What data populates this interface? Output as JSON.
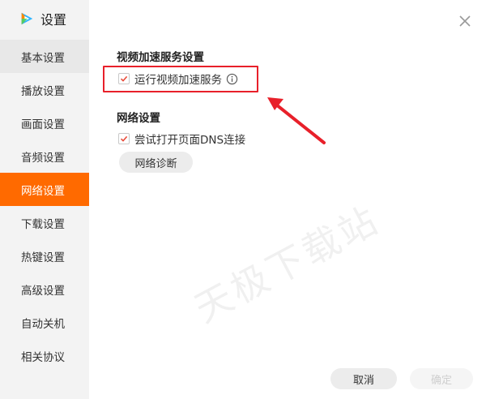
{
  "app": {
    "title": "设置",
    "logo_icon": "tencent-video-logo-icon"
  },
  "sidebar": {
    "items": [
      {
        "label": "基本设置"
      },
      {
        "label": "播放设置"
      },
      {
        "label": "画面设置"
      },
      {
        "label": "音频设置"
      },
      {
        "label": "网络设置"
      },
      {
        "label": "下载设置"
      },
      {
        "label": "热键设置"
      },
      {
        "label": "高级设置"
      },
      {
        "label": "自动关机"
      },
      {
        "label": "相关协议"
      }
    ],
    "active_index": 4,
    "active_color": "#ff6a00"
  },
  "main": {
    "accel": {
      "title": "视频加速服务设置",
      "option_label": "运行视频加速服务",
      "checked": true
    },
    "network": {
      "title": "网络设置",
      "option_label": "尝试打开页面DNS连接",
      "checked": true,
      "diag_label": "网络诊断"
    }
  },
  "footer": {
    "cancel_label": "取消",
    "ok_label": "确定"
  },
  "watermark": "天极下载站",
  "colors": {
    "accent": "#ff6a00",
    "check": "#e84b3a",
    "highlight": "#e8202a"
  }
}
